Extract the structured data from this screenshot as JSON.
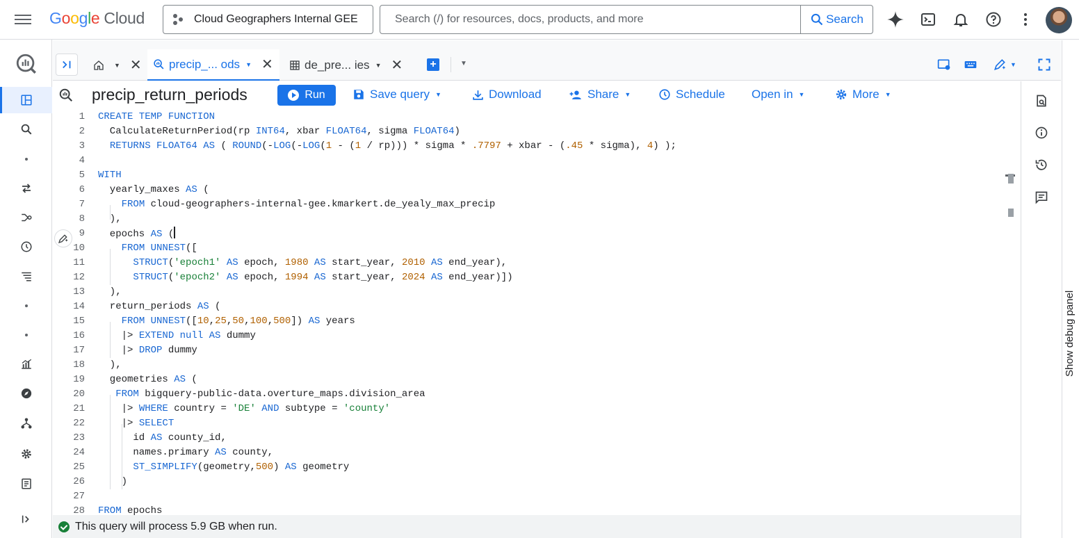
{
  "header": {
    "logo_google": [
      "G",
      "o",
      "o",
      "g",
      "l",
      "e"
    ],
    "logo_cloud": "Cloud",
    "project_name": "Cloud Geographers Internal GEE",
    "search_placeholder": "Search (/) for resources, docs, products, and more",
    "search_button": "Search"
  },
  "tabs": [
    {
      "label": "precip_... ods",
      "active": true
    },
    {
      "label": "de_pre... ies",
      "active": false
    }
  ],
  "toolbar": {
    "title": "precip_return_periods",
    "run": "Run",
    "save_query": "Save query",
    "download": "Download",
    "share": "Share",
    "schedule": "Schedule",
    "open_in": "Open in",
    "more": "More"
  },
  "editor": {
    "line_numbers": [
      "1",
      "2",
      "3",
      "4",
      "5",
      "6",
      "7",
      "8",
      "9",
      "10",
      "11",
      "12",
      "13",
      "14",
      "15",
      "16",
      "17",
      "18",
      "19",
      "20",
      "21",
      "22",
      "23",
      "24",
      "25",
      "26",
      "27",
      "28"
    ]
  },
  "status": {
    "message": "This query will process 5.9 GB when run."
  },
  "debug_panel": {
    "label": "Show debug panel"
  },
  "colors": {
    "accent": "#1a73e8",
    "keyword": "#1967d2",
    "number": "#b06000",
    "string": "#188038",
    "success": "#188038"
  }
}
